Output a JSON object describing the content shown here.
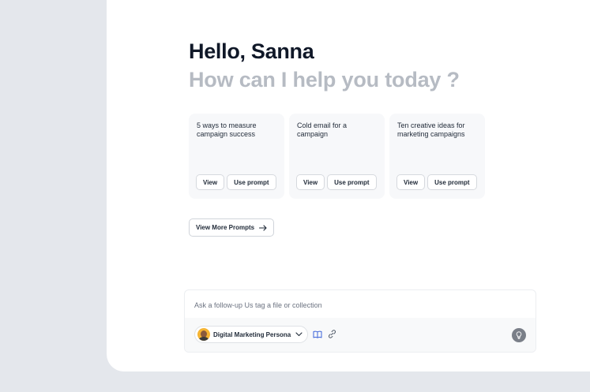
{
  "greeting": "Hello, Sanna",
  "subtitle": "How can I help you today ?",
  "cards": [
    {
      "title": "5 ways to measure campaign success",
      "view_label": "View",
      "use_label": "Use prompt"
    },
    {
      "title": "Cold email for a campaign",
      "view_label": "View",
      "use_label": "Use prompt"
    },
    {
      "title": "Ten creative ideas for marketing campaigns",
      "view_label": "View",
      "use_label": "Use prompt"
    }
  ],
  "more_prompts_label": "View More Prompts",
  "composer": {
    "placeholder": "Ask a follow-up Us tag a file or collection",
    "persona_label": "Digital Marketing Persona"
  },
  "icons": {
    "arrow": "arrow-right-icon",
    "chevron": "chevron-down-icon",
    "book": "book-icon",
    "link": "link-icon",
    "bulb": "lightbulb-icon"
  },
  "colors": {
    "background": "#e4e7ec",
    "panel": "#ffffff",
    "subtitle": "#b6bbc3",
    "card": "#f7f8fa",
    "accent_blue": "#3b63d9",
    "avatar": "#f5b433"
  }
}
